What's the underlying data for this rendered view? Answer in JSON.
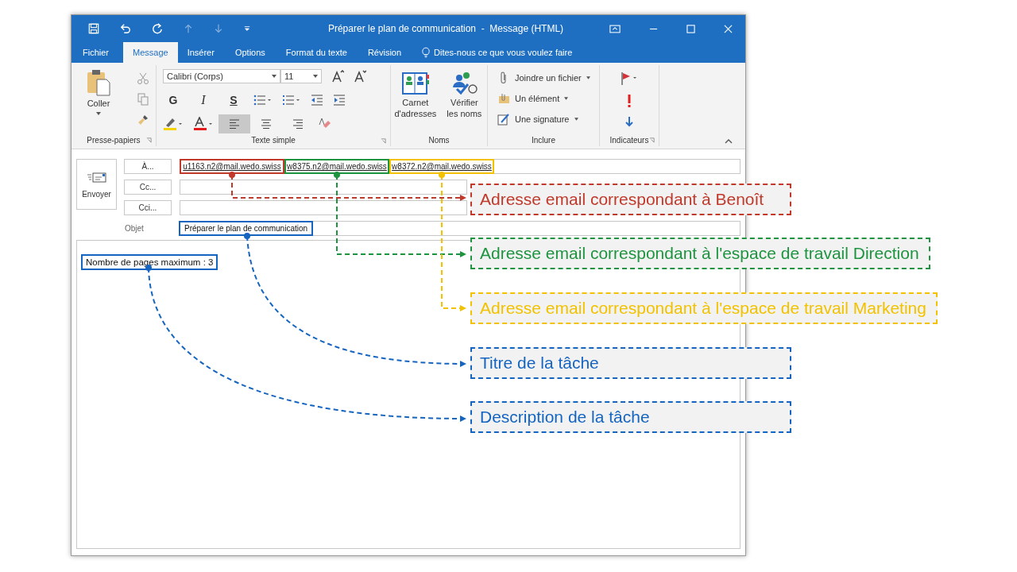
{
  "window": {
    "title": "Préparer le plan de communication  -  Message (HTML)"
  },
  "ribbon_tabs": [
    {
      "label": "Fichier",
      "selected": false
    },
    {
      "label": "Message",
      "selected": true
    },
    {
      "label": "Insérer",
      "selected": false
    },
    {
      "label": "Options",
      "selected": false
    },
    {
      "label": "Format du texte",
      "selected": false
    },
    {
      "label": "Révision",
      "selected": false
    }
  ],
  "tell_me": "Dites-nous ce que vous voulez faire",
  "ribbon": {
    "clipboard": {
      "paste": "Coller",
      "group": "Presse-papiers"
    },
    "font": {
      "family": "Calibri (Corps)",
      "size": "11",
      "bold": "G",
      "italic": "I",
      "underline": "S",
      "group": "Texte simple",
      "alignments": [
        {
          "kind": "left",
          "selected": true
        },
        {
          "kind": "center",
          "selected": false
        },
        {
          "kind": "right",
          "selected": false
        }
      ]
    },
    "names": {
      "address_book": "Carnet d'adresses",
      "check_names": "Vérifier les noms",
      "group": "Noms"
    },
    "include": {
      "items": [
        {
          "kind": "attach",
          "label": "Joindre un fichier"
        },
        {
          "kind": "item",
          "label": "Un élément"
        },
        {
          "kind": "signature",
          "label": "Une signature"
        }
      ],
      "group": "Inclure"
    },
    "tags": {
      "group": "Indicateurs"
    }
  },
  "send": "Envoyer",
  "address_buttons": [
    "À...",
    "Cc...",
    "Cci..."
  ],
  "subject_label": "Objet",
  "recipients": [
    {
      "address": "u1163.n2@mail.wedo.swiss",
      "color": "#c0392b"
    },
    {
      "address": "w8375.n2@mail.wedo.swiss",
      "color": "#1e9440"
    },
    {
      "address": "w8372.n2@mail.wedo.swiss",
      "color": "#f2c200"
    }
  ],
  "subject": "Préparer le plan de communication",
  "body": "Nombre de pages maximum : 3",
  "annotations": [
    {
      "text": "Adresse email correspondant à Benoît",
      "color": "#c0392b"
    },
    {
      "text": "Adresse email correspondant à l'espace de travail Direction",
      "color": "#1e9440"
    },
    {
      "text": "Adresse email correspondant à l'espace de travail Marketing",
      "color": "#f2c200"
    },
    {
      "text": "Titre de la tâche",
      "color": "#1565c0"
    },
    {
      "text": "Description de la tâche",
      "color": "#1565c0"
    }
  ]
}
